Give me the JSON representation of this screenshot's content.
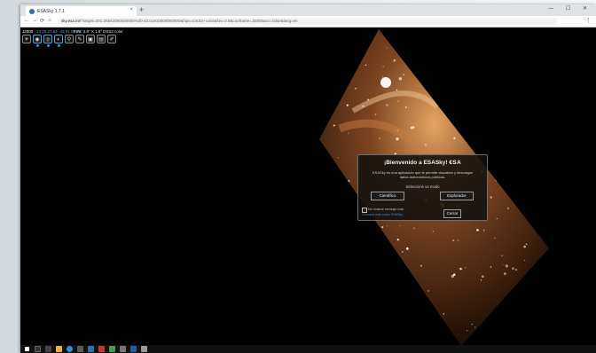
{
  "browser": {
    "tab_title": "ESASky 1.7.1",
    "new_tab": "+",
    "tab_close": "×",
    "window_controls": "— ☐ ✕",
    "url_host": "sky.esa.int",
    "url_rest": "/?target=201.36542000000000%20-43.01910000000000&hips=DSS2+color&fov=3.9&cooframe=J2000&sci=false&lang=es"
  },
  "app_header": {
    "coord_frame": "J2000",
    "coords": "13 25 27.62 -43 01 09.06",
    "fov": "FoV: 3.9° X 1.8°",
    "survey": "DSS2 color"
  },
  "toolbar": [
    "☀",
    "◉",
    "◎",
    "◐",
    "⚲",
    "✎",
    "▣",
    "▤",
    "✐"
  ],
  "dialog": {
    "title": "¡Bienvenido a ESASky!",
    "esa_logo": "€SA",
    "description": "ESASky es una aplicación que le permite visualizar y descargar datos astronómicos públicos.",
    "select_mode": "Seleccione un modo",
    "scientist_button": "Científico",
    "explorer_button": "Explorador",
    "dont_show": "No mostrar mensaje más",
    "link": "Conozca más sobre ESASky",
    "close_button": "Cerrar"
  },
  "colors": {
    "accent": "#2e9ad0",
    "link": "#3d8ed6"
  }
}
